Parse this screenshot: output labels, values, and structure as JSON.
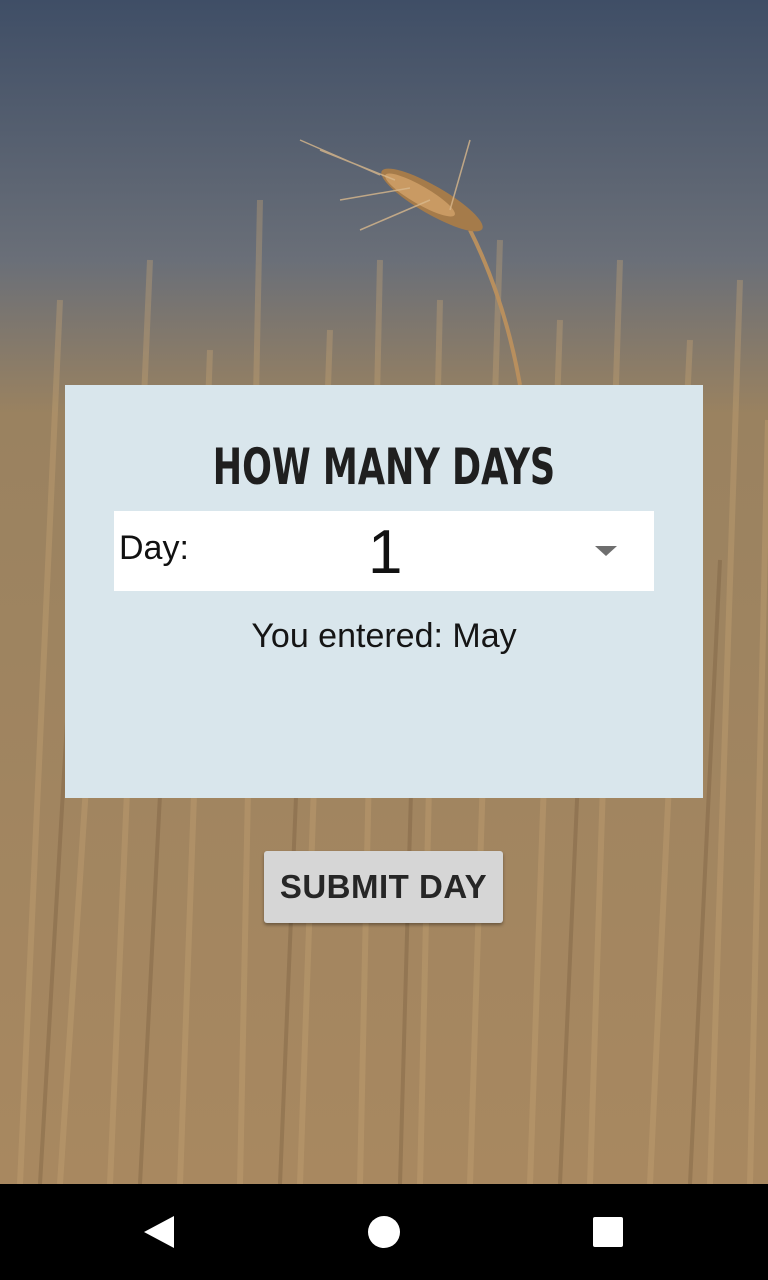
{
  "app": {
    "title": "HOW MANY DAYS"
  },
  "day_selector": {
    "label": "Day:",
    "selected_value": "1"
  },
  "result": {
    "text": "You entered: May"
  },
  "actions": {
    "submit_label": "SUBMIT DAY"
  },
  "colors": {
    "card_background": "#d9e6ec",
    "button_background": "#d6d6d6",
    "navbar_background": "#000000"
  },
  "icons": {
    "dropdown": "chevron-down-icon",
    "nav_back": "back-icon",
    "nav_home": "home-icon",
    "nav_recents": "recents-icon"
  }
}
